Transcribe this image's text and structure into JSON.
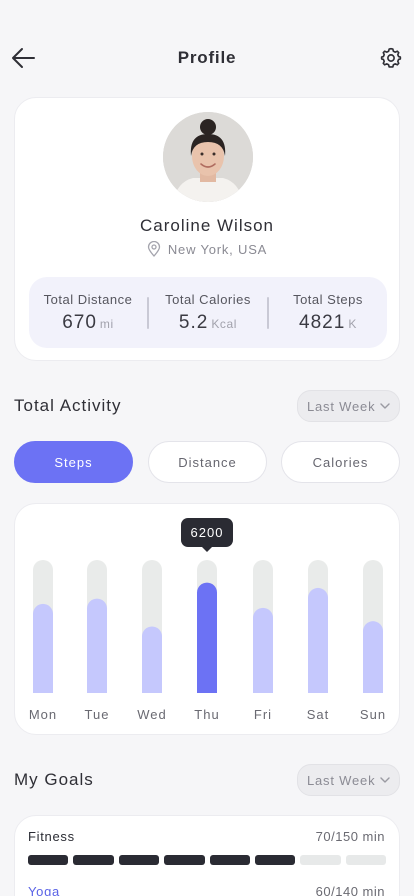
{
  "header": {
    "title": "Profile",
    "back_icon": "arrow-left-icon",
    "settings_icon": "gear-icon"
  },
  "profile": {
    "name": "Caroline Wilson",
    "location": "New York, USA",
    "location_icon": "map-pin-icon",
    "stats": [
      {
        "label": "Total Distance",
        "value": "670",
        "unit": "mi"
      },
      {
        "label": "Total Calories",
        "value": "5.2",
        "unit": "Kcal"
      },
      {
        "label": "Total Steps",
        "value": "4821",
        "unit": "K"
      }
    ]
  },
  "activity": {
    "title": "Total Activity",
    "period": "Last Week",
    "tabs": [
      "Steps",
      "Distance",
      "Calories"
    ],
    "active_tab": "Steps"
  },
  "chart_data": {
    "type": "bar",
    "categories": [
      "Mon",
      "Tue",
      "Wed",
      "Thu",
      "Fri",
      "Sat",
      "Sun"
    ],
    "values": [
      0.67,
      0.71,
      0.5,
      0.83,
      0.64,
      0.79,
      0.54
    ],
    "highlight_index": 3,
    "tooltip": "6200",
    "colors": {
      "bar": "#c5c8fd",
      "highlight": "#6c72f4",
      "track": "#e9ebea",
      "tooltip_bg": "#2a2b33"
    }
  },
  "goals": {
    "title": "My Goals",
    "period": "Last Week",
    "items": [
      {
        "name": "Fitness",
        "value": "70/150 min",
        "filled_segments": 6,
        "total_segments": 8,
        "color": "#2a2b33"
      },
      {
        "name": "Yoga",
        "value": "60/140 min",
        "color": "#5a63e6"
      }
    ]
  },
  "colors": {
    "accent": "#6c72f4",
    "text": "#2f2f36",
    "muted": "#8a8a93"
  }
}
